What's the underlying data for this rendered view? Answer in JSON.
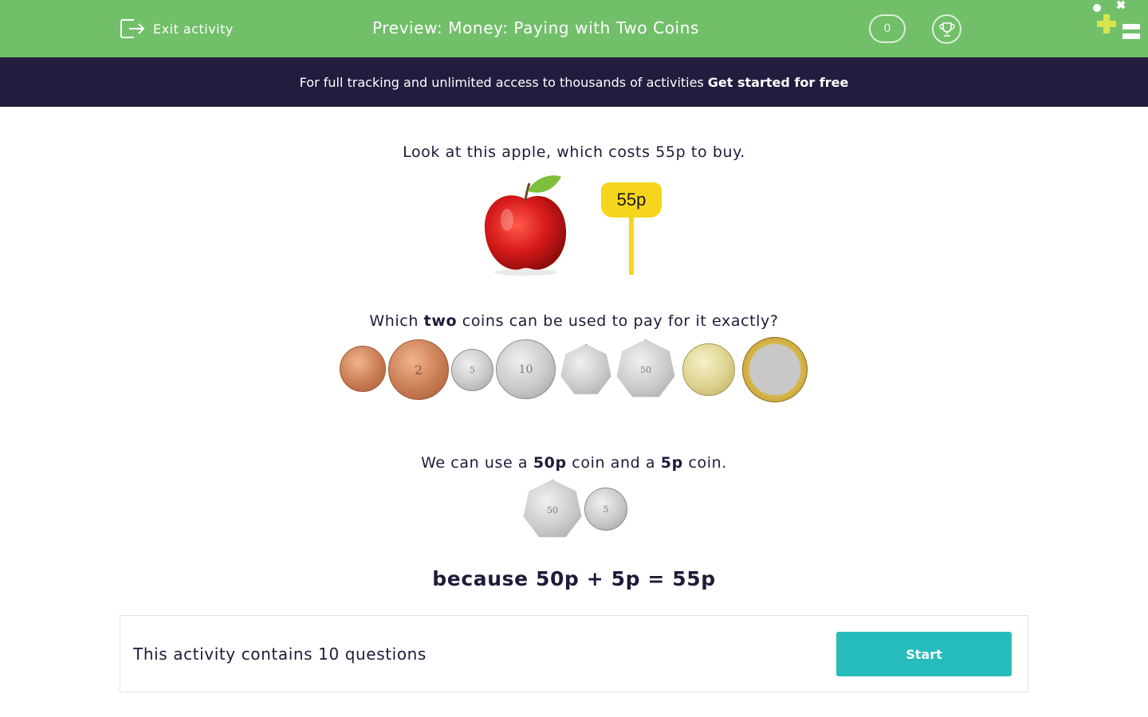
{
  "header": {
    "exit_label": "Exit activity",
    "title": "Preview: Money: Paying with Two Coins",
    "score": "0",
    "brand_color": "#72bf6a"
  },
  "banner": {
    "text": "For full tracking and unlimited access to thousands of activities",
    "cta": "Get started for free"
  },
  "question": {
    "intro": "Look at this apple, which costs 55p to buy.",
    "price_tag": "55p",
    "prompt_pre": "Which",
    "prompt_bold": "two",
    "prompt_post": "coins can be used to pay for it exactly?",
    "coins": [
      {
        "name": "1p",
        "label": ""
      },
      {
        "name": "2p",
        "label": "2"
      },
      {
        "name": "5p",
        "label": "5"
      },
      {
        "name": "10p",
        "label": "10"
      },
      {
        "name": "20p",
        "label": ""
      },
      {
        "name": "50p",
        "label": "50"
      },
      {
        "name": "£1",
        "label": ""
      },
      {
        "name": "£2",
        "label": ""
      }
    ]
  },
  "explanation": {
    "pre": "We can use a",
    "coin_a": "50p",
    "mid": "coin and a",
    "coin_b": "5p",
    "post": "coin.",
    "answer_coin_labels": [
      "50",
      "5"
    ],
    "because": "because 50p + 5p = 55p"
  },
  "footer": {
    "info": "This activity contains 10 questions",
    "start_label": "Start",
    "start_color": "#26bcbc"
  }
}
